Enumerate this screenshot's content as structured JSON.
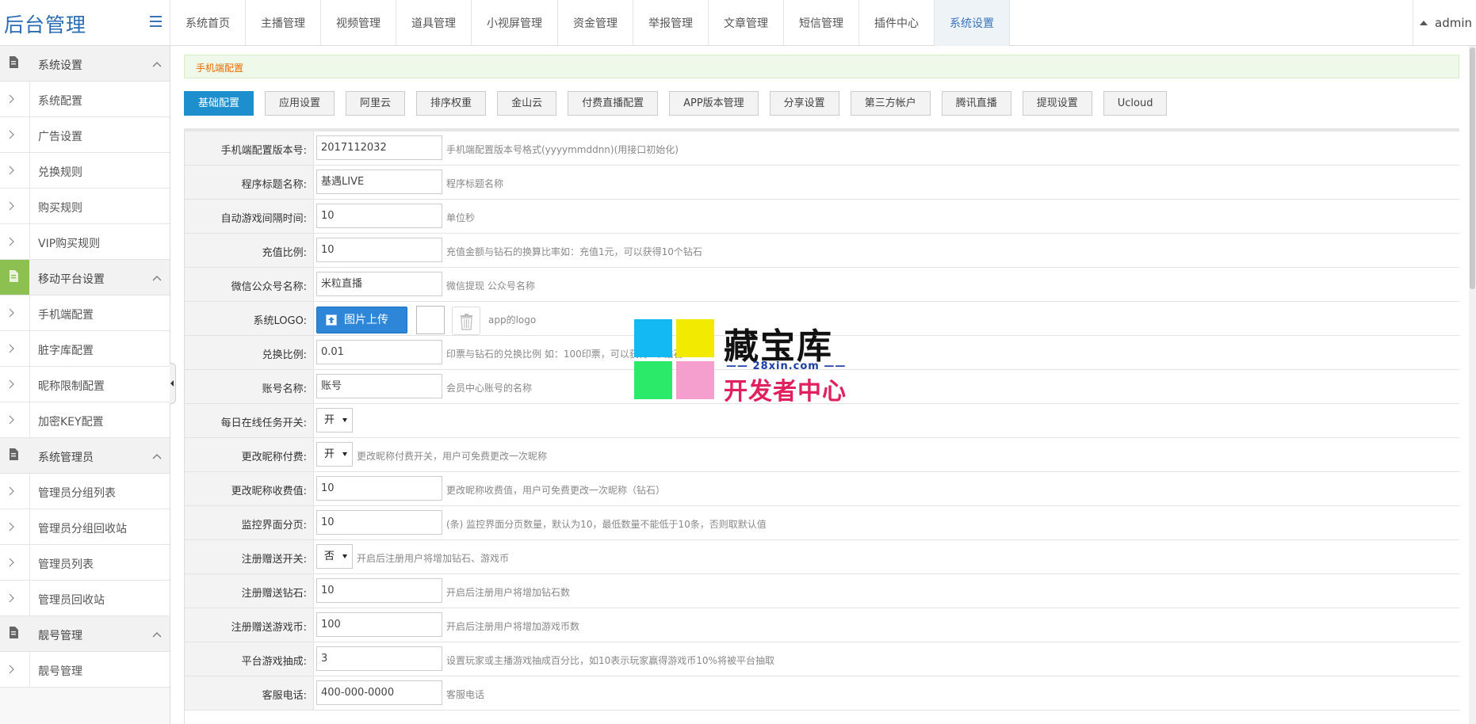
{
  "brand": {
    "title": "后台管理"
  },
  "topnav": [
    {
      "label": "系统首页"
    },
    {
      "label": "主播管理"
    },
    {
      "label": "视频管理"
    },
    {
      "label": "道具管理"
    },
    {
      "label": "小视屏管理"
    },
    {
      "label": "资金管理"
    },
    {
      "label": "举报管理"
    },
    {
      "label": "文章管理"
    },
    {
      "label": "短信管理"
    },
    {
      "label": "插件中心"
    },
    {
      "label": "系统设置",
      "active": true
    }
  ],
  "user": {
    "name": "admin"
  },
  "sidebar": {
    "groups": [
      {
        "label": "系统设置",
        "items": [
          "系统配置",
          "广告设置",
          "兑换规则",
          "购买规则",
          "VIP购买规则"
        ]
      },
      {
        "label": "移动平台设置",
        "items": [
          "手机端配置",
          "脏字库配置",
          "昵称限制配置",
          "加密KEY配置"
        ]
      },
      {
        "label": "系统管理员",
        "items": [
          "管理员分组列表",
          "管理员分组回收站",
          "管理员列表",
          "管理员回收站"
        ]
      },
      {
        "label": "靓号管理",
        "items": [
          "靓号管理"
        ]
      }
    ]
  },
  "notice": {
    "text": "手机端配置"
  },
  "tabs": [
    {
      "label": "基础配置",
      "active": true
    },
    {
      "label": "应用设置"
    },
    {
      "label": "阿里云"
    },
    {
      "label": "排序权重"
    },
    {
      "label": "金山云"
    },
    {
      "label": "付费直播配置"
    },
    {
      "label": "APP版本管理"
    },
    {
      "label": "分享设置"
    },
    {
      "label": "第三方帐户"
    },
    {
      "label": "腾讯直播"
    },
    {
      "label": "提现设置"
    },
    {
      "label": "Ucloud"
    }
  ],
  "form": {
    "rows": [
      {
        "label": "手机端配置版本号:",
        "type": "input",
        "value": "2017112032",
        "hint": "手机端配置版本号格式(yyyymmddnn)(用接口初始化)"
      },
      {
        "label": "程序标题名称:",
        "type": "input",
        "value": "基遇LIVE",
        "hint": "程序标题名称"
      },
      {
        "label": "自动游戏间隔时间:",
        "type": "input",
        "value": "10",
        "hint": "单位秒"
      },
      {
        "label": "充值比例:",
        "type": "input",
        "value": "10",
        "hint": "充值金额与钻石的换算比率如：充值1元，可以获得10个钻石"
      },
      {
        "label": "微信公众号名称:",
        "type": "input",
        "value": "米粒直播",
        "hint": "微信提现 公众号名称"
      },
      {
        "label": "系统LOGO:",
        "type": "logo",
        "button": "图片上传",
        "hint": "app的logo"
      },
      {
        "label": "兑换比例:",
        "type": "input",
        "value": "0.01",
        "hint": "印票与钻石的兑换比例 如：100印票，可以获得1个钻石"
      },
      {
        "label": "账号名称:",
        "type": "input",
        "value": "账号",
        "hint": "会员中心账号的名称"
      },
      {
        "label": "每日在线任务开关:",
        "type": "select",
        "value": "开",
        "hint": ""
      },
      {
        "label": "更改昵称付费:",
        "type": "select",
        "value": "开",
        "hint": "更改昵称付费开关，用户可免费更改一次昵称"
      },
      {
        "label": "更改昵称收费值:",
        "type": "input",
        "value": "10",
        "hint": "更改昵称收费值，用户可免费更改一次昵称（钻石）"
      },
      {
        "label": "监控界面分页:",
        "type": "input",
        "value": "10",
        "hint": "(条) 监控界面分页数量，默认为10，最低数量不能低于10条，否则取默认值"
      },
      {
        "label": "注册赠送开关:",
        "type": "select",
        "value": "否",
        "hint": "开启后注册用户将增加钻石、游戏币"
      },
      {
        "label": "注册赠送钻石:",
        "type": "input",
        "value": "10",
        "hint": "开启后注册用户将增加钻石数"
      },
      {
        "label": "注册赠送游戏币:",
        "type": "input",
        "value": "100",
        "hint": "开启后注册用户将增加游戏币数"
      },
      {
        "label": "平台游戏抽成:",
        "type": "input",
        "value": "3",
        "hint": "设置玩家或主播游戏抽成百分比，如10表示玩家赢得游戏币10%将被平台抽取"
      },
      {
        "label": "客服电话:",
        "type": "input",
        "value": "400-000-0000",
        "hint": "客服电话"
      }
    ]
  },
  "watermark": {
    "title": "藏宝库",
    "domain": "—— 28xin.com ——",
    "subtitle": "开发者中心",
    "colors": [
      "#12b9f2",
      "#f2ea00",
      "#2bea6a",
      "#f49fcd"
    ]
  },
  "colors": {
    "accent": "#1c8fcc",
    "brand": "#2a6cb3",
    "sidebar_active": "#8cc151"
  }
}
